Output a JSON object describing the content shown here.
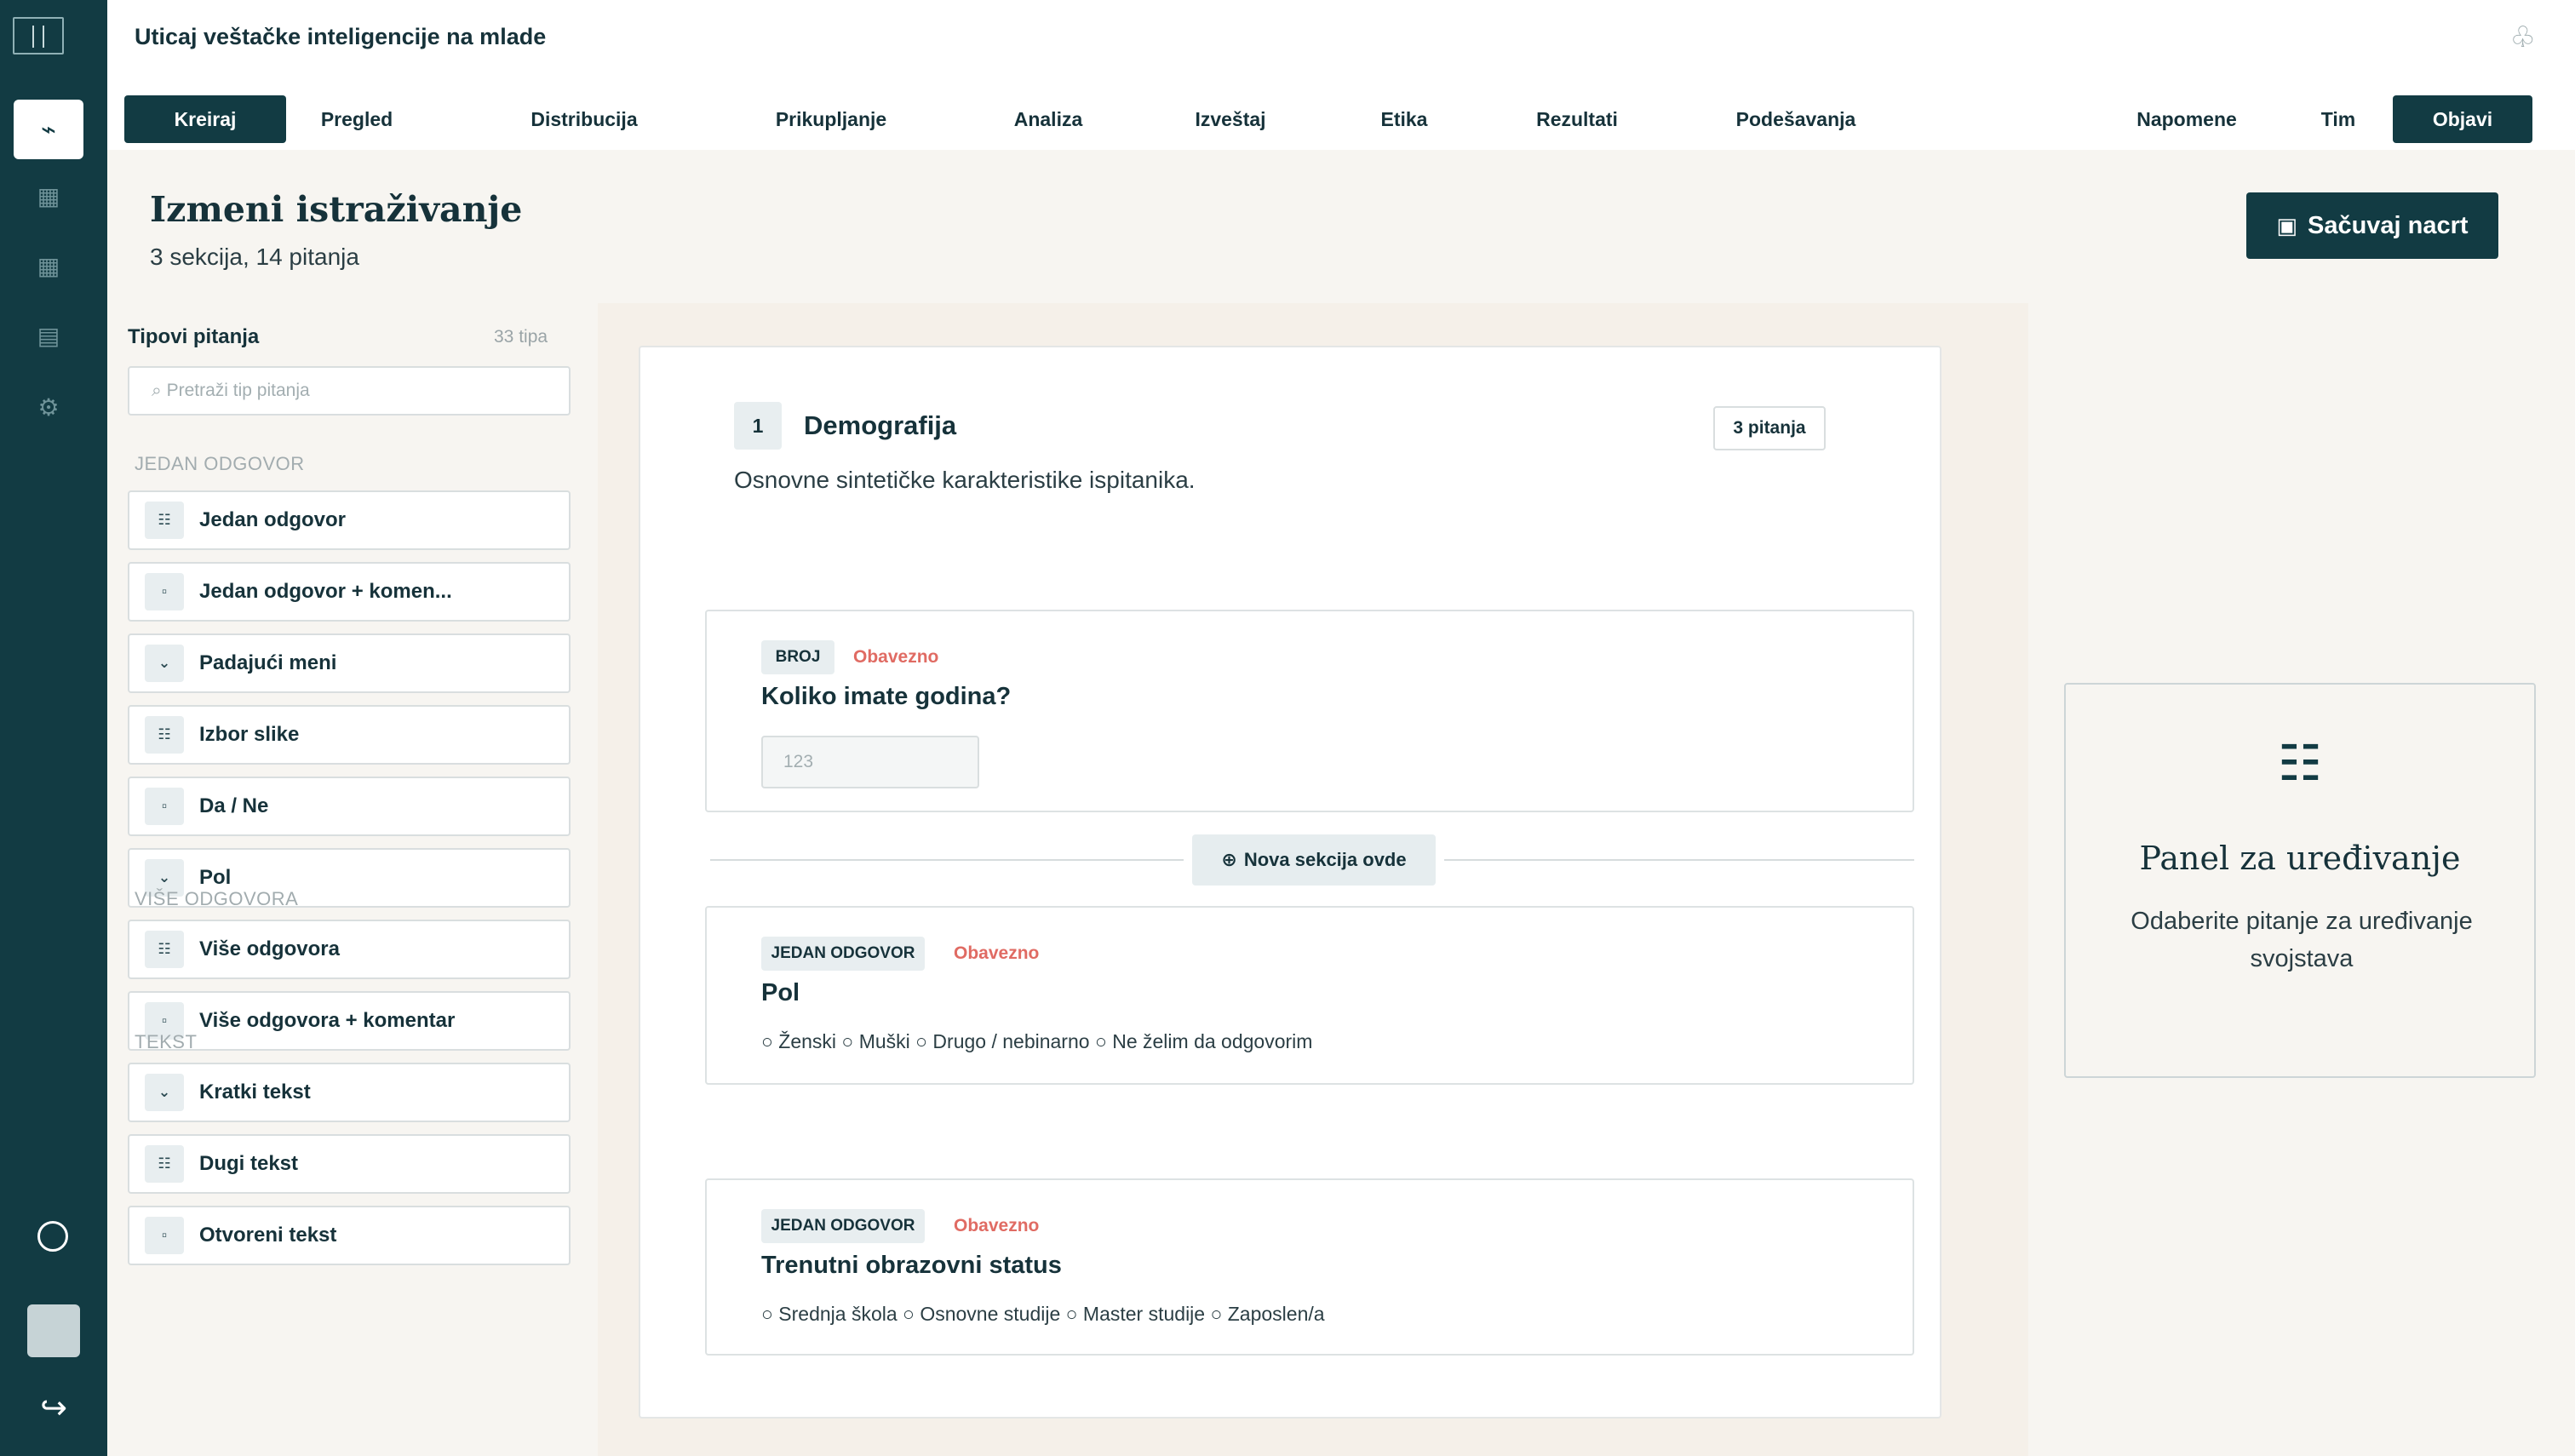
{
  "app": {
    "title": "Uticaj veštačke inteligencije na mlade"
  },
  "rail": {
    "logo_icon": "panel-layout-icon",
    "items": [
      {
        "icon": "bolt-icon",
        "glyph": "⌁"
      },
      {
        "icon": "grid-icon",
        "glyph": "▦"
      },
      {
        "icon": "grid-icon",
        "glyph": "▦"
      },
      {
        "icon": "list-icon",
        "glyph": "▤"
      },
      {
        "icon": "gear-icon",
        "glyph": "⚙"
      }
    ],
    "logout_glyph": "↪"
  },
  "header": {
    "sync_glyph": "♧"
  },
  "tabs": {
    "kreiraj": "Kreiraj",
    "pregled": "Pregled",
    "distribucija": "Distribucija",
    "prikupljanje": "Prikupljanje",
    "analiza": "Analiza",
    "izvestaj": "Izveštaj",
    "etika": "Etika",
    "rezultati": "Rezultati",
    "podesavanja": "Podešavanja",
    "napomene": "Napomene",
    "tim": "Tim",
    "objavi": "Objavi"
  },
  "page": {
    "title": "Izmeni istraživanje",
    "subtitle": "3 sekcija, 14 pitanja",
    "save_icon": "▣",
    "save_label": "Sačuvaj nacrt"
  },
  "library": {
    "title": "Tipovi pitanja",
    "count": "33 tipa",
    "search_placeholder": "⌕ Pretraži tip pitanja",
    "groups": {
      "single": "JEDAN ODGOVOR",
      "multiple": "VIŠE ODGOVORA",
      "text": "TEKST"
    },
    "items": [
      {
        "glyph": "☷",
        "label": "Jedan odgovor"
      },
      {
        "glyph": "▫",
        "label": "Jedan odgovor + komen..."
      },
      {
        "glyph": "⌄",
        "label": "Padajući meni"
      },
      {
        "glyph": "☷",
        "label": "Izbor slike"
      },
      {
        "glyph": "▫",
        "label": "Da / Ne"
      },
      {
        "glyph": "⌄",
        "label": "Pol"
      },
      {
        "glyph": "☷",
        "label": "Više odgovora"
      },
      {
        "glyph": "▫",
        "label": "Više odgovora + komentar"
      },
      {
        "glyph": "⌄",
        "label": "Kratki tekst"
      },
      {
        "glyph": "☷",
        "label": "Dugi tekst"
      },
      {
        "glyph": "▫",
        "label": "Otvoreni tekst"
      }
    ]
  },
  "section": {
    "number": "1",
    "title": "Demografija",
    "badge": "3 pitanja",
    "description": "Osnovne sintetičke karakteristike ispitanika."
  },
  "questions": [
    {
      "type": "BROJ",
      "required": "Obavezno",
      "title": "Koliko imate godina?",
      "input_placeholder": "123"
    },
    {
      "type": "JEDAN ODGOVOR",
      "required": "Obavezno",
      "title": "Pol",
      "options": "○ Ženski ○ Muški ○ Drugo / nebinarno ○ Ne želim da odgovorim"
    },
    {
      "type": "JEDAN ODGOVOR",
      "required": "Obavezno",
      "title": "Trenutni obrazovni status",
      "options": "○ Srednja škola ○ Osnovne studije ○ Master studije ○ Zaposlen/a"
    }
  ],
  "new_section": {
    "icon": "⊕",
    "label": "Nova sekcija ovde"
  },
  "edit_panel": {
    "icon": "☷",
    "title": "Panel za uređivanje",
    "text": "Odaberite pitanje za uređivanje svojstava"
  }
}
